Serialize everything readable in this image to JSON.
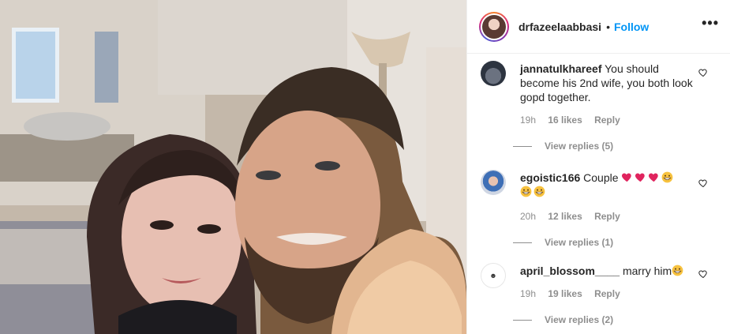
{
  "post": {
    "username": "drfazeelaabbasi",
    "separator": "•",
    "follow_label": "Follow",
    "more_icon": "more-options-icon",
    "more_label": "•••"
  },
  "comments": [
    {
      "username": "jannatulkhareef",
      "text": "You should become his 2nd wife, you both look gopd together.",
      "time": "19h",
      "likes": "16 likes",
      "reply_label": "Reply",
      "view_replies": "View replies (5)"
    },
    {
      "username": "egoistic166",
      "text": "Couple",
      "emojis": [
        "red-heart",
        "red-heart",
        "red-heart",
        "grinning-face",
        "grinning-face",
        "grinning-face"
      ],
      "time": "20h",
      "likes": "12 likes",
      "reply_label": "Reply",
      "view_replies": "View replies (1)"
    },
    {
      "username": "april_blossom____",
      "text": "marry him",
      "emojis": [
        "grinning-face"
      ],
      "time": "19h",
      "likes": "19 likes",
      "reply_label": "Reply",
      "view_replies": "View replies (2)"
    }
  ],
  "colors": {
    "link_blue": "#0095f6",
    "meta_gray": "#8e8e8e",
    "text": "#262626",
    "heart_red": "#ed4956",
    "emoji_yellow": "#f7c23f"
  }
}
